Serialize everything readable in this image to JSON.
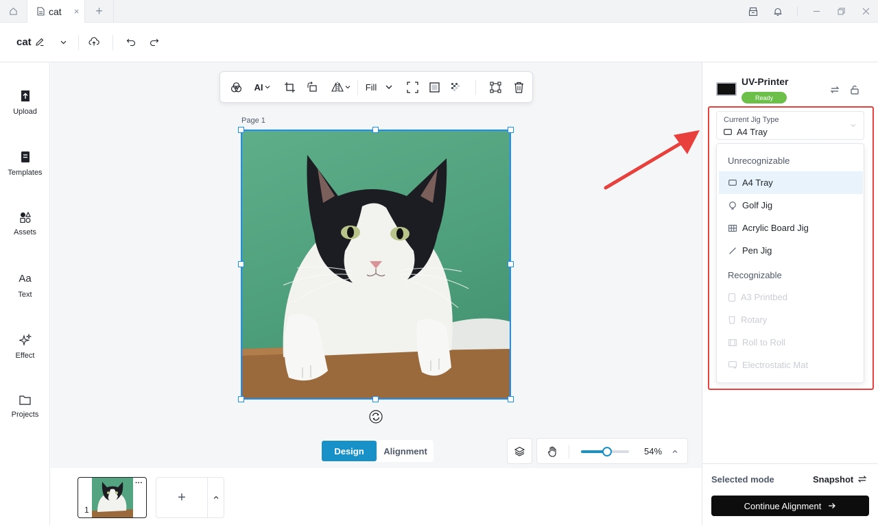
{
  "tabbar": {
    "doc_tab_title": "cat",
    "close_glyph": "×",
    "add_glyph": "+"
  },
  "header": {
    "doc_title": "cat"
  },
  "sidebar": {
    "items": [
      {
        "label": "Upload",
        "icon": "upload-icon"
      },
      {
        "label": "Templates",
        "icon": "templates-icon"
      },
      {
        "label": "Assets",
        "icon": "assets-icon"
      },
      {
        "label": "Text",
        "icon": "text-icon",
        "glyph": "Aa"
      },
      {
        "label": "Effect",
        "icon": "sparkle-icon"
      },
      {
        "label": "Projects",
        "icon": "folder-icon"
      }
    ]
  },
  "toolbar": {
    "ai_label": "AI",
    "fill_label": "Fill"
  },
  "canvas": {
    "page_label": "Page 1"
  },
  "mode_switch": {
    "design": "Design",
    "alignment": "Alignment",
    "active": "Design"
  },
  "zoom": {
    "value_label": "54%",
    "level": 0.54
  },
  "pages": {
    "thumb_number": "1",
    "more_glyph": "···",
    "add_glyph": "+"
  },
  "device": {
    "name": "UV-Printer",
    "status": "Ready",
    "status_color": "#6cc04a"
  },
  "jig": {
    "caption": "Current Jig Type",
    "current": "A4 Tray",
    "groups": [
      {
        "label": "Unrecognizable",
        "options": [
          {
            "label": "A4 Tray",
            "icon": "tray-icon",
            "selected": true
          },
          {
            "label": "Golf Jig",
            "icon": "golf-icon"
          },
          {
            "label": "Acrylic Board Jig",
            "icon": "grid-icon"
          },
          {
            "label": "Pen Jig",
            "icon": "pen-icon"
          }
        ]
      },
      {
        "label": "Recognizable",
        "options": [
          {
            "label": "A3 Printbed",
            "icon": "printbed-icon",
            "disabled": true
          },
          {
            "label": "Rotary",
            "icon": "rotary-icon",
            "disabled": true
          },
          {
            "label": "Roll to Roll",
            "icon": "film-icon",
            "disabled": true
          },
          {
            "label": "Electrostatic Mat",
            "icon": "mat-icon",
            "disabled": true
          }
        ]
      }
    ]
  },
  "footer": {
    "selected_mode_label": "Selected mode",
    "selected_mode_value": "Snapshot",
    "continue_label": "Continue Alignment"
  },
  "colors": {
    "accent": "#1890c8",
    "selection": "#1a8cff",
    "annotation": "#e8403c"
  }
}
